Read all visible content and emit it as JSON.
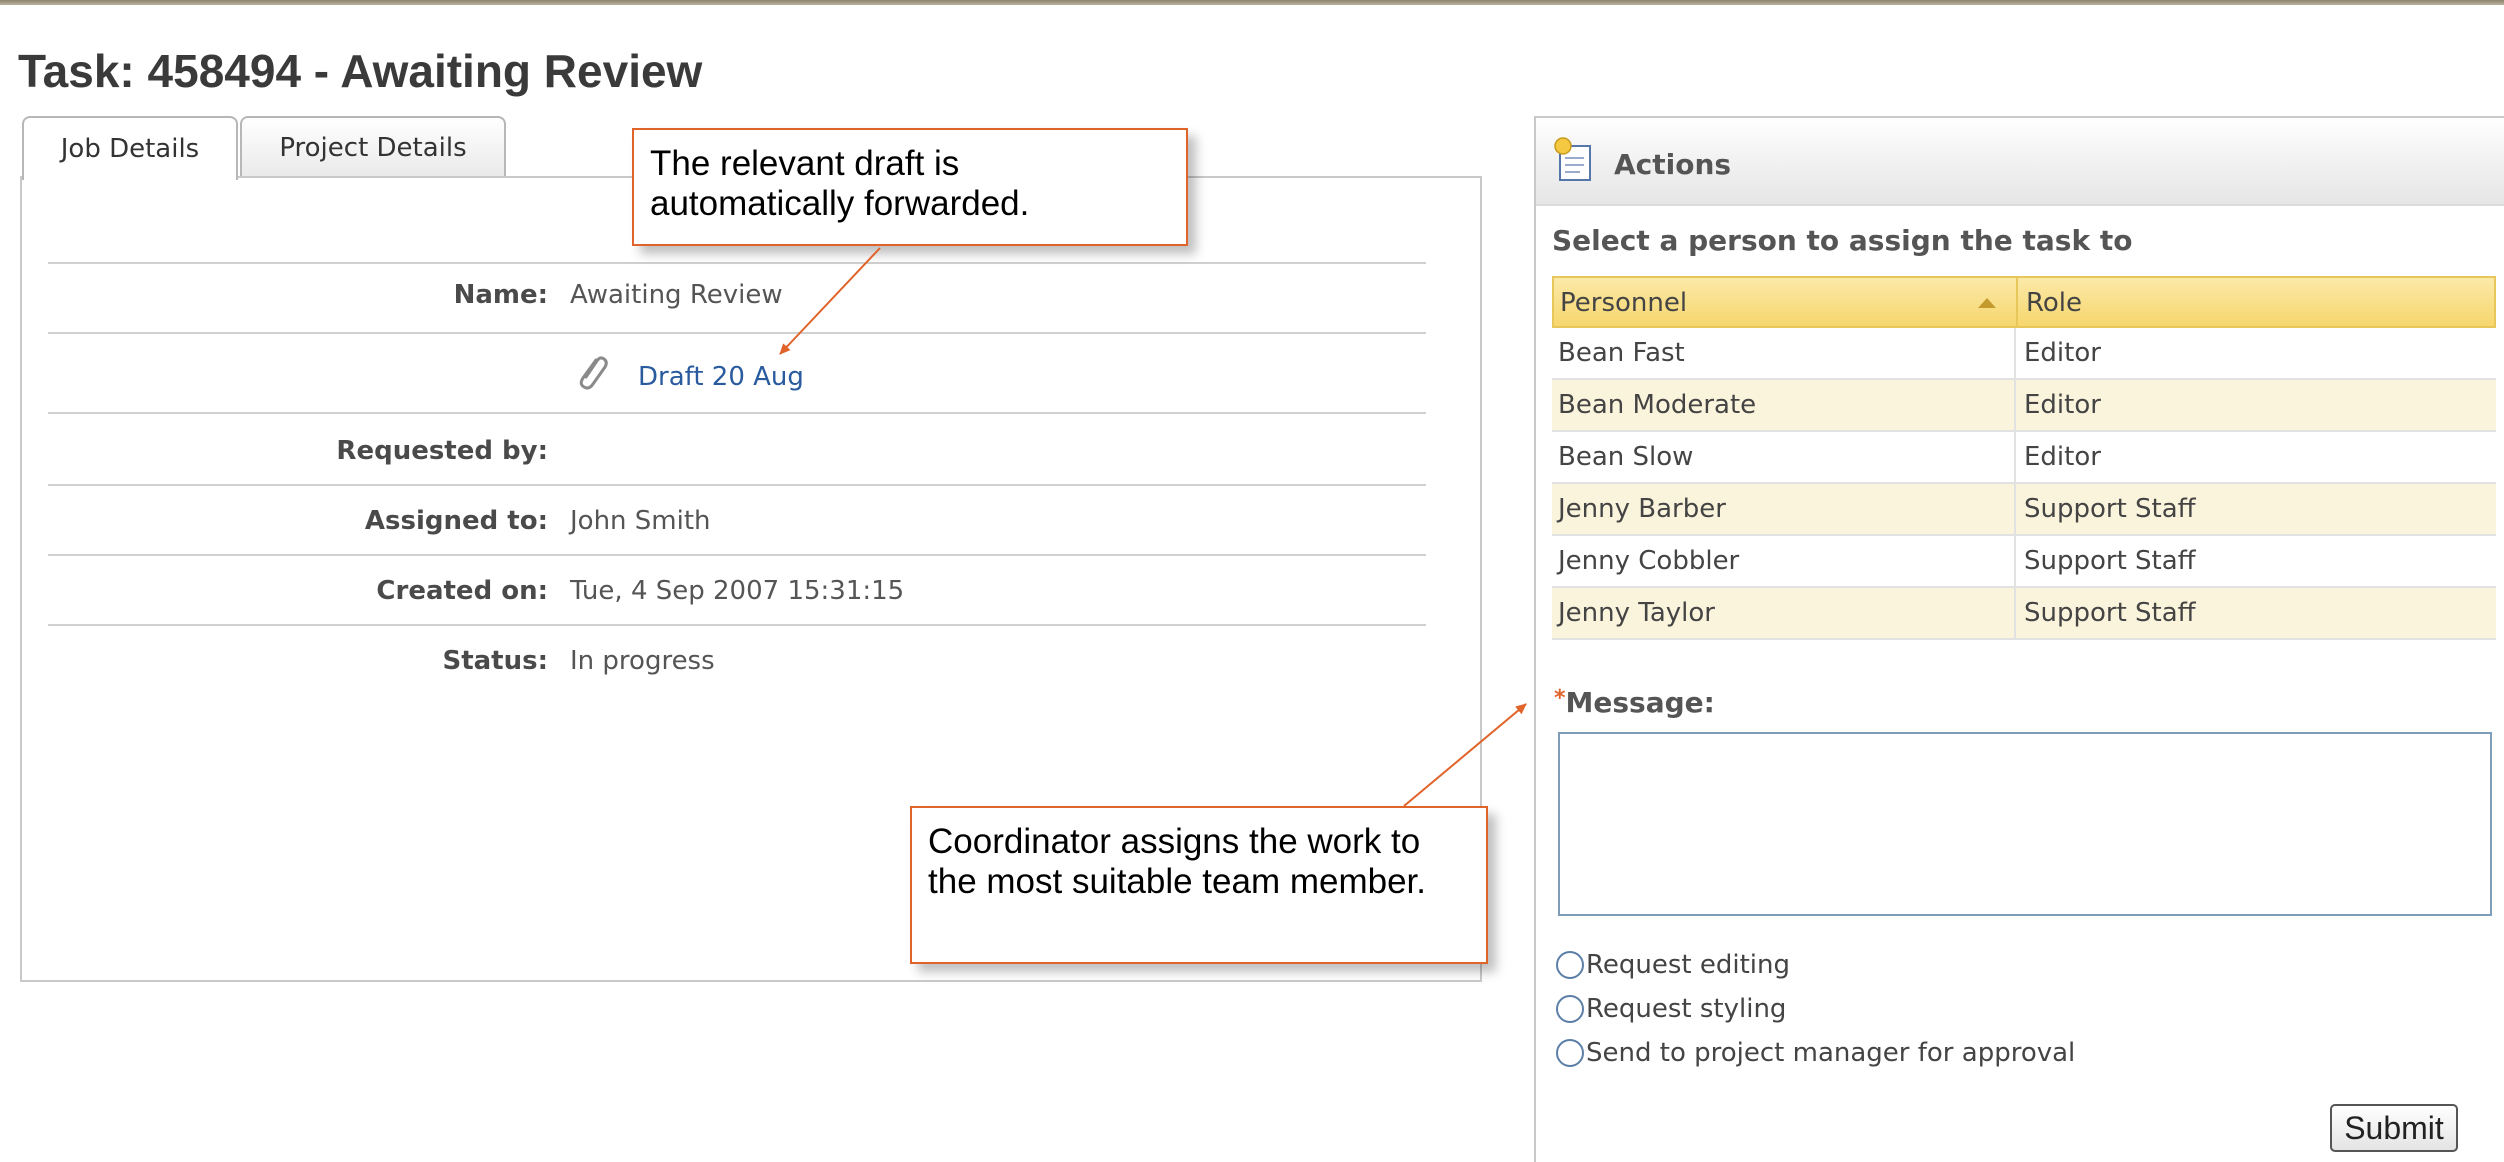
{
  "page": {
    "title": "Task: 458494 - Awaiting Review"
  },
  "tabs": [
    {
      "label": "Job Details"
    },
    {
      "label": "Project Details"
    }
  ],
  "job_details": {
    "name_label": "Name:",
    "name_value": "Awaiting Review",
    "attachment_link": "Draft 20 Aug",
    "requested_by_label": "Requested by:",
    "requested_by_value": "",
    "assigned_to_label": "Assigned to:",
    "assigned_to_value": "John Smith",
    "created_on_label": "Created on:",
    "created_on_value": "Tue, 4 Sep 2007 15:31:15",
    "status_label": "Status:",
    "status_value": "In progress"
  },
  "callouts": {
    "draft_forward": "The relevant draft is automatically forwarded.",
    "coordinator": "Coordinator assigns the work to the most suitable team member."
  },
  "actions": {
    "title": "Actions",
    "select_label": "Select a person to assign the task to",
    "columns": {
      "personnel": "Personnel",
      "role": "Role"
    },
    "rows": [
      {
        "person": "Bean Fast",
        "role": "Editor"
      },
      {
        "person": "Bean Moderate",
        "role": "Editor"
      },
      {
        "person": "Bean Slow",
        "role": "Editor"
      },
      {
        "person": "Jenny Barber",
        "role": "Support Staff"
      },
      {
        "person": "Jenny Cobbler",
        "role": "Support Staff"
      },
      {
        "person": "Jenny Taylor",
        "role": "Support Staff"
      }
    ],
    "message_required_mark": "*",
    "message_label": "Message:",
    "message_value": "",
    "options": [
      {
        "label": "Request editing",
        "selected": false
      },
      {
        "label": "Request styling",
        "selected": false
      },
      {
        "label": "Send to project manager for approval",
        "selected": false
      }
    ],
    "submit_label": "Submit"
  },
  "colors": {
    "callout_border": "#e0632a",
    "link": "#2a5b9e",
    "grid_header": "#f6d66d",
    "grid_alt_row": "#fbf4dc"
  }
}
